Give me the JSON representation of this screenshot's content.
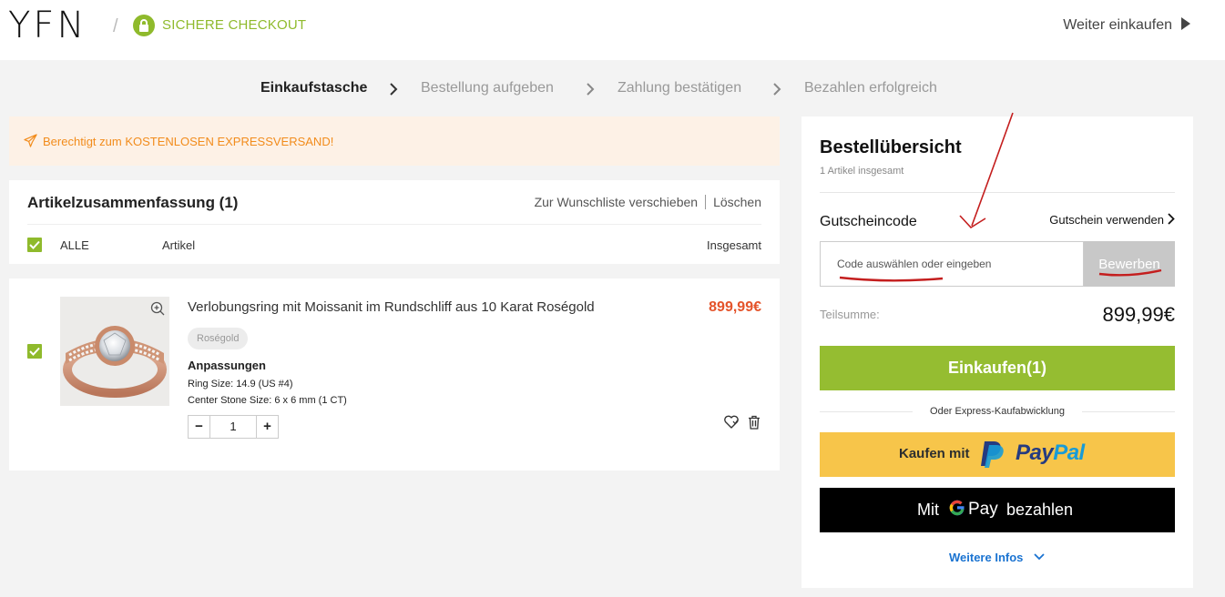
{
  "header": {
    "logo": "YFN",
    "separator": "/",
    "secure_label": "SICHERE CHECKOUT",
    "continue_label": "Weiter einkaufen"
  },
  "steps": [
    {
      "label": "Einkaufstasche",
      "active": true
    },
    {
      "label": "Bestellung aufgeben",
      "active": false
    },
    {
      "label": "Zahlung bestätigen",
      "active": false
    },
    {
      "label": "Bezahlen erfolgreich",
      "active": false
    }
  ],
  "banner": {
    "text": "Berechtigt zum KOSTENLOSEN EXPRESSVERSAND!",
    "icon": "plane-icon"
  },
  "cart": {
    "title": "Artikelzusammenfassung (1)",
    "wishlist_action": "Zur Wunschliste verschieben",
    "delete_action": "Löschen",
    "select_all_label": "ALLE",
    "col_article": "Artikel",
    "col_total": "Insgesamt",
    "items": [
      {
        "name": "Verlobungsring mit Moissanit im Rundschliff aus 10 Karat Roségold",
        "price": "899,99€",
        "variant": "Roségold",
        "customizations_title": "Anpassungen",
        "customizations": [
          "Ring Size: 14.9 (US #4)",
          "Center Stone Size: 6 x 6 mm (1 CT)"
        ],
        "quantity": "1",
        "checked": true
      }
    ]
  },
  "order_summary": {
    "title": "Bestellübersicht",
    "item_count": "1 Artikel insgesamt",
    "coupon_label": "Gutscheincode",
    "coupon_link": "Gutschein verwenden",
    "coupon_placeholder": "Code auswählen oder eingeben",
    "apply_label": "Bewerben",
    "subtotal_label": "Teilsumme:",
    "subtotal_value": "899,99€",
    "checkout_label": "Einkaufen(1)",
    "express_label": "Oder Express-Kaufabwicklung",
    "paypal_prefix": "Kaufen mit",
    "paypal_brand_pay": "Pay",
    "paypal_brand_pal": "Pal",
    "gpay_prefix": "Mit",
    "gpay_brand": "Pay",
    "gpay_suffix": "bezahlen",
    "more_info": "Weitere Infos"
  },
  "colors": {
    "accent_green": "#95bd31",
    "price_red": "#e4532a",
    "banner_orange": "#f28c1c",
    "paypal_yellow": "#f7c54a",
    "link_blue": "#1a73d1",
    "annotation_red": "#c41e1e"
  }
}
